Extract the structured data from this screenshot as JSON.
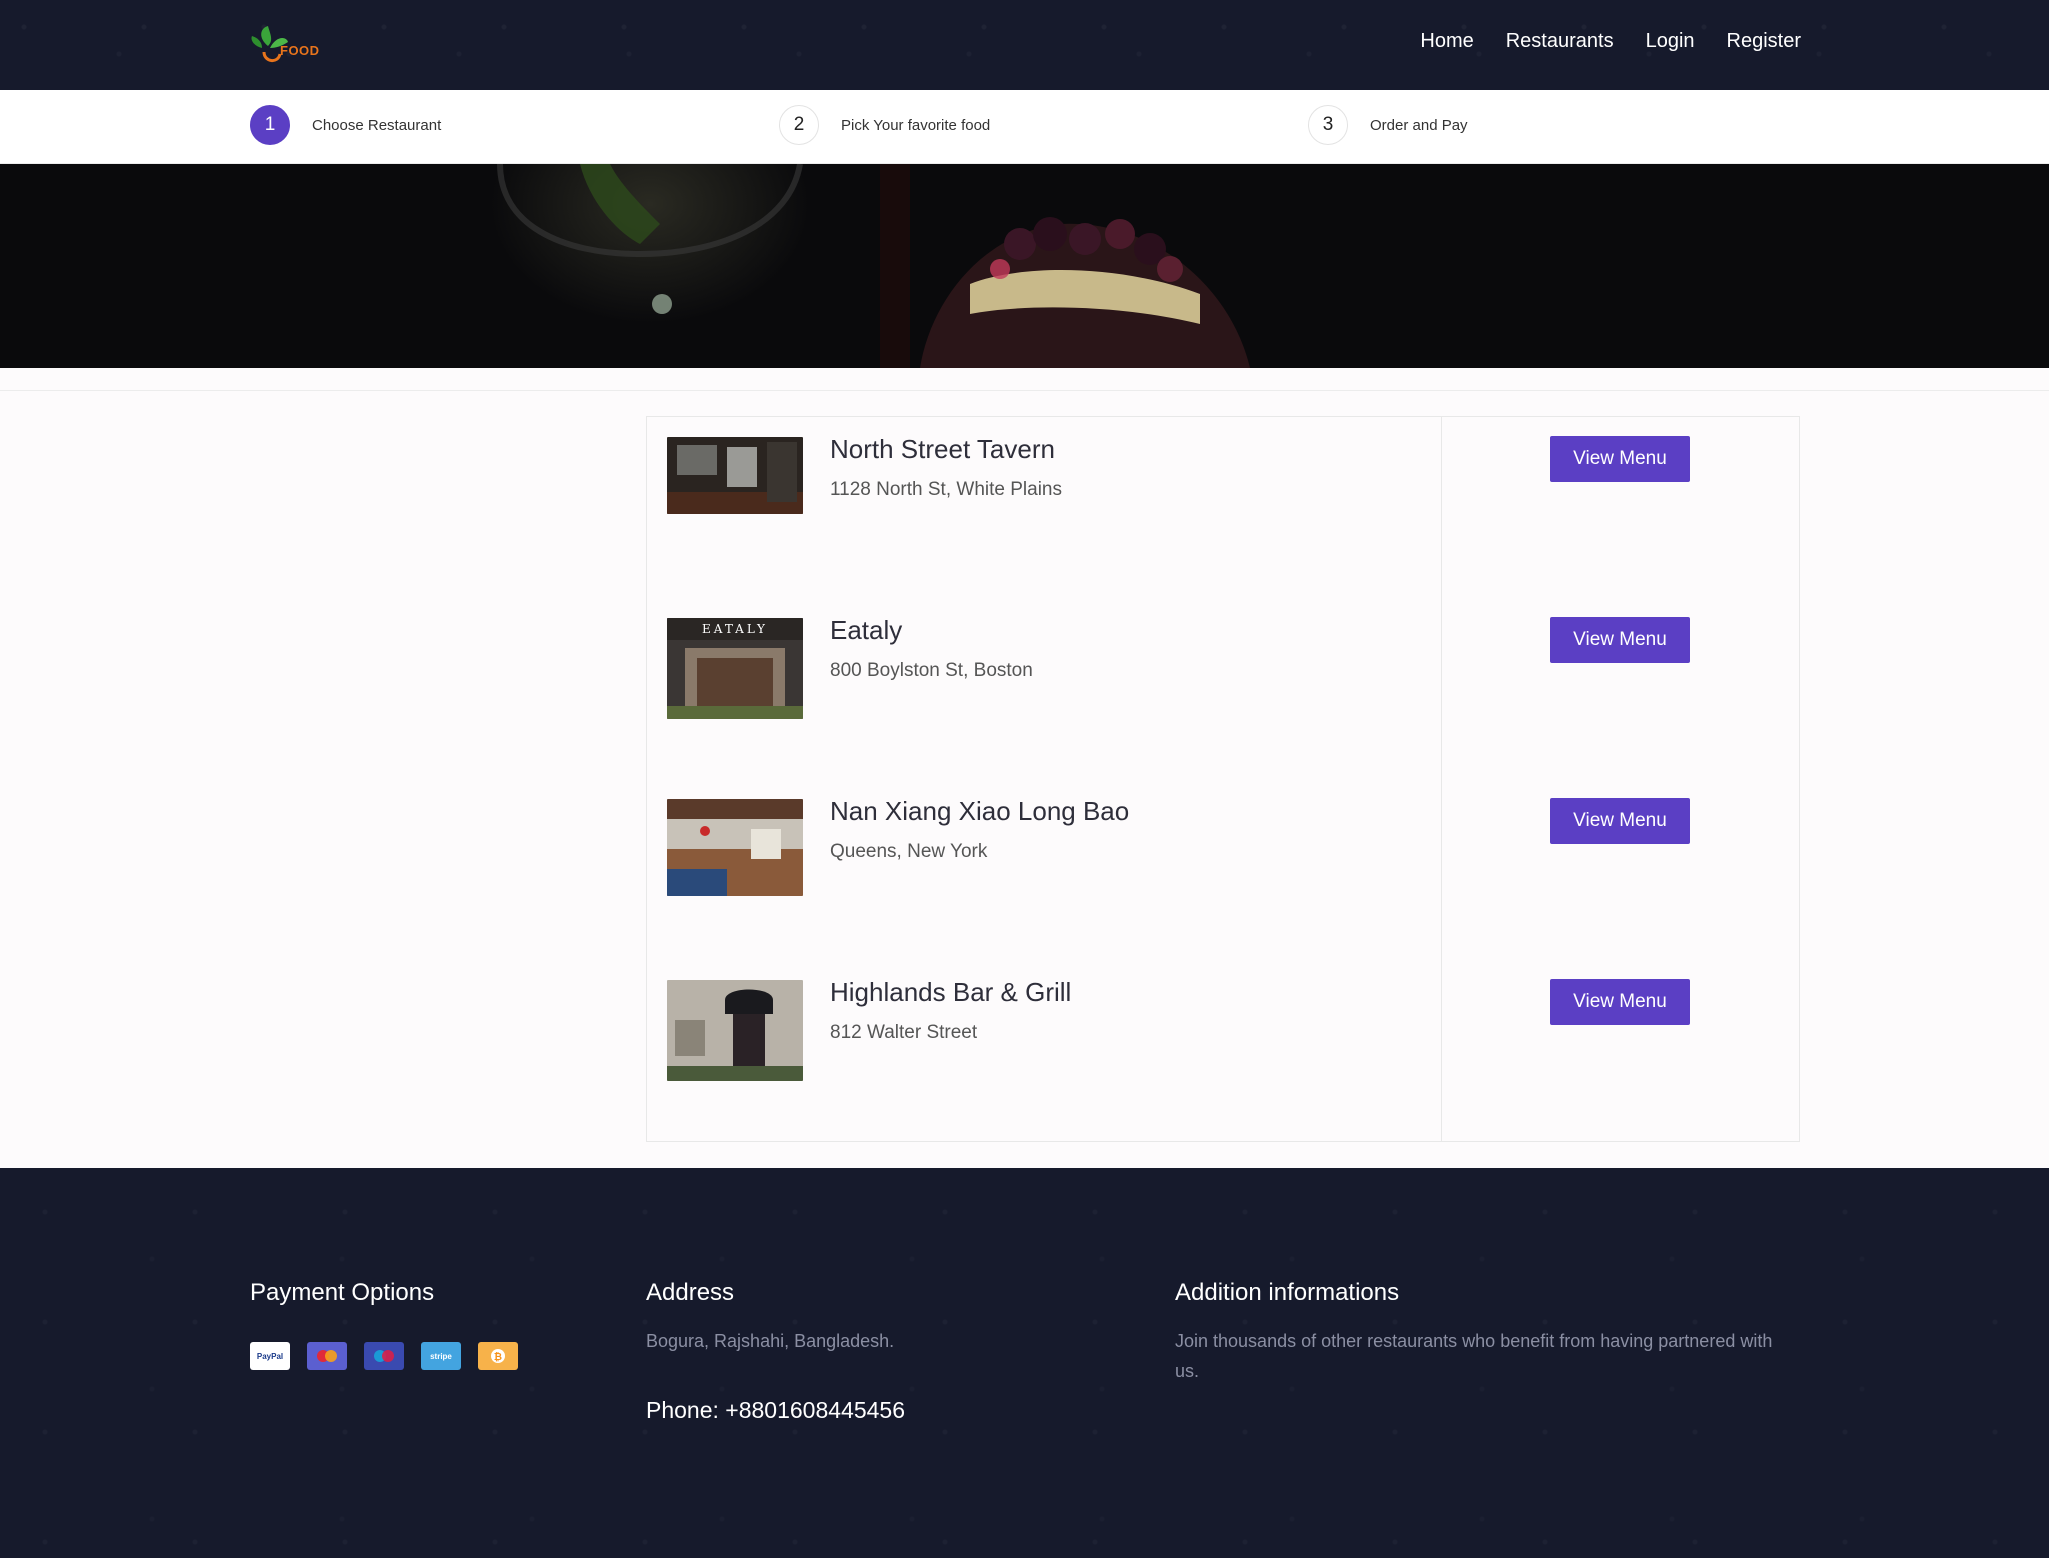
{
  "header": {
    "logo_text": "FOOD",
    "nav": [
      "Home",
      "Restaurants",
      "Login",
      "Register"
    ]
  },
  "steps": [
    {
      "number": "1",
      "label": "Choose Restaurant",
      "active": true
    },
    {
      "number": "2",
      "label": "Pick Your favorite food",
      "active": false
    },
    {
      "number": "3",
      "label": "Order and Pay",
      "active": false
    }
  ],
  "restaurants": [
    {
      "name": "North Street Tavern",
      "address": "1128 North St, White Plains",
      "button": "View Menu"
    },
    {
      "name": "Eataly",
      "address": "800 Boylston St, Boston",
      "button": "View Menu",
      "sign_text": "EATALY"
    },
    {
      "name": "Nan Xiang Xiao Long Bao",
      "address": "Queens, New York",
      "button": "View Menu"
    },
    {
      "name": "Highlands Bar & Grill",
      "address": "812 Walter Street",
      "button": "View Menu"
    }
  ],
  "footer": {
    "payment_title": "Payment Options",
    "payment_methods": [
      "PayPal",
      "Mastercard",
      "Maestro",
      "stripe",
      "Bitcoin"
    ],
    "payment_colors": [
      "#ffffff",
      "#5b5fd0",
      "#3a4ab0",
      "#43a4e0",
      "#f7b24a"
    ],
    "address_title": "Address",
    "address": "Bogura, Rajshahi, Bangladesh.",
    "phone": "Phone: +8801608445456",
    "info_title": "Addition informations",
    "info_text": "Join thousands of other restaurants who benefit from having partnered with us."
  },
  "colors": {
    "accent": "#5b3fc4",
    "dark": "#161a2c"
  }
}
